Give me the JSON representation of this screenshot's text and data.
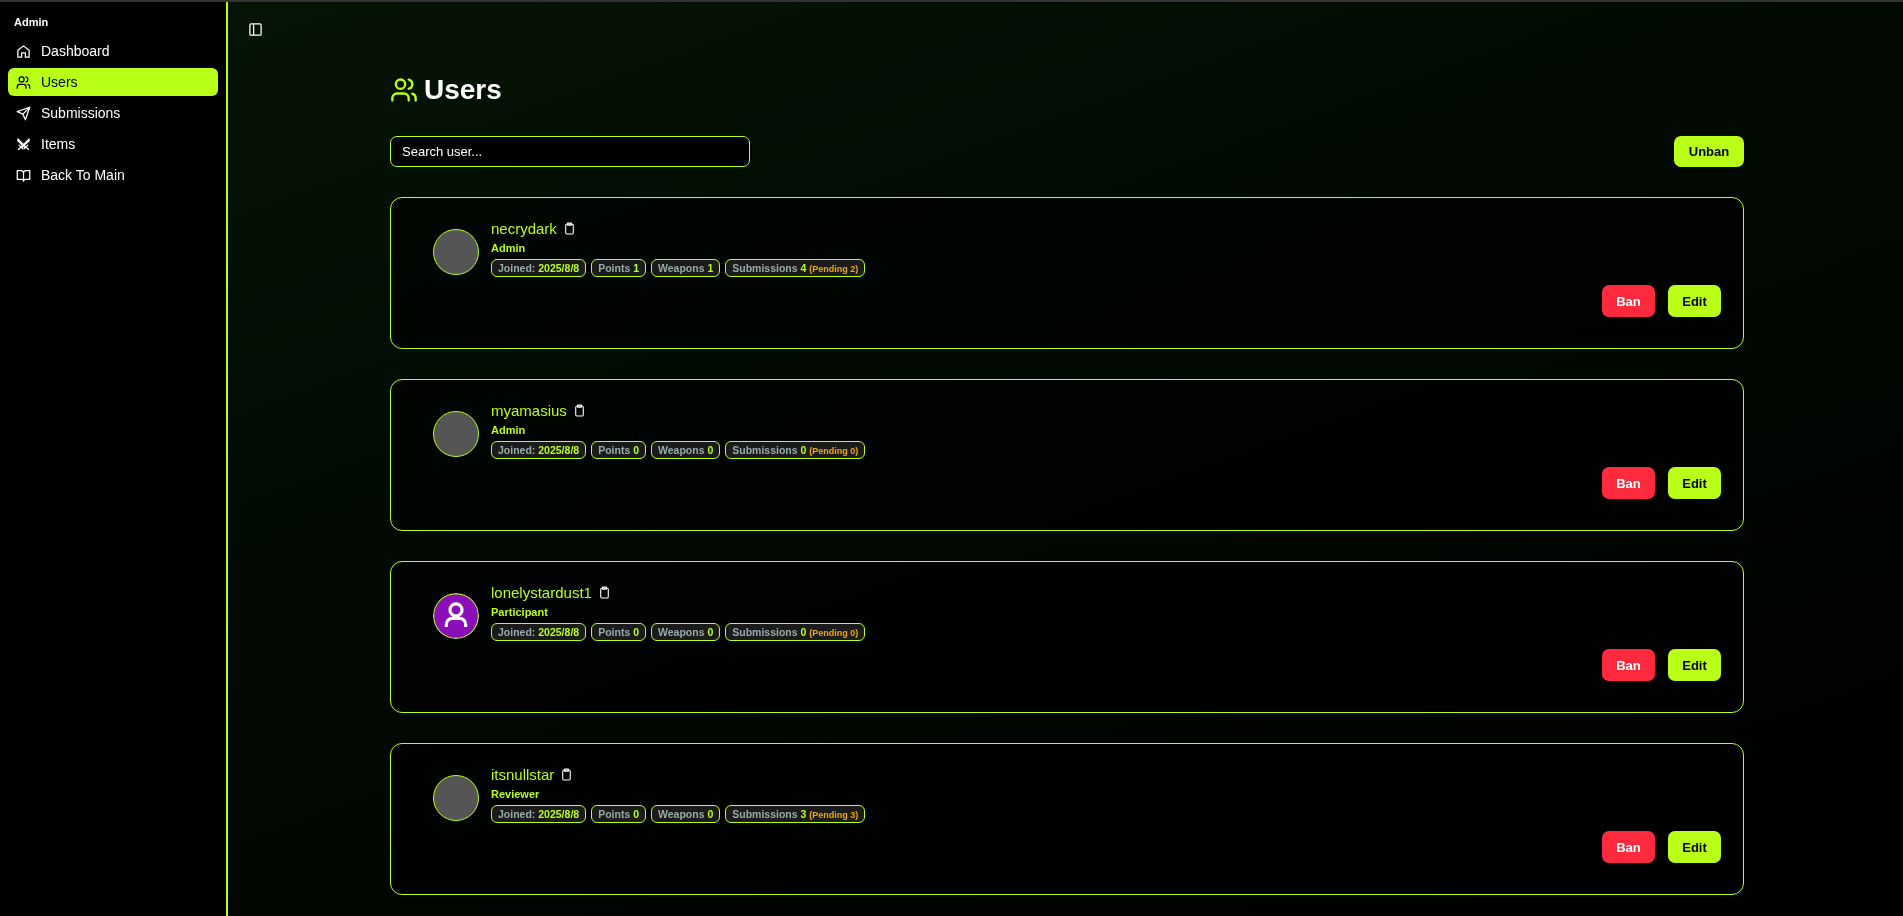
{
  "sidebar": {
    "group_label": "Admin",
    "items": [
      {
        "label": "Dashboard",
        "kind": "home",
        "selected": false
      },
      {
        "label": "Users",
        "kind": "users",
        "selected": true
      },
      {
        "label": "Submissions",
        "kind": "send",
        "selected": false
      },
      {
        "label": "Items",
        "kind": "swords",
        "selected": false
      },
      {
        "label": "Back To Main",
        "kind": "book",
        "selected": false
      }
    ]
  },
  "page": {
    "title": "Users",
    "search": {
      "placeholder": "Search user..."
    },
    "unban_button": "Unban"
  },
  "users": [
    {
      "name": "necrydark",
      "role": "Admin",
      "kind": "photo",
      "joined_label": "Joined:",
      "joined": "2025/8/8",
      "points_label": "Points",
      "points": "1",
      "weapons_label": "Weapons",
      "weapons": "1",
      "submissions_label": "Submissions",
      "submissions": "4",
      "pending": "(Pending 2)",
      "ban": "Ban",
      "edit": "Edit"
    },
    {
      "name": "myamasius",
      "role": "Admin",
      "kind": "photo",
      "joined_label": "Joined:",
      "joined": "2025/8/8",
      "points_label": "Points",
      "points": "0",
      "weapons_label": "Weapons",
      "weapons": "0",
      "submissions_label": "Submissions",
      "submissions": "0",
      "pending": "(Pending 0)",
      "ban": "Ban",
      "edit": "Edit"
    },
    {
      "name": "lonelystardust1",
      "role": "Participant",
      "kind": "default",
      "joined_label": "Joined:",
      "joined": "2025/8/8",
      "points_label": "Points",
      "points": "0",
      "weapons_label": "Weapons",
      "weapons": "0",
      "submissions_label": "Submissions",
      "submissions": "0",
      "pending": "(Pending 0)",
      "ban": "Ban",
      "edit": "Edit"
    },
    {
      "name": "itsnullstar",
      "role": "Reviewer",
      "kind": "photo",
      "joined_label": "Joined:",
      "joined": "2025/8/8",
      "points_label": "Points",
      "points": "0",
      "weapons_label": "Weapons",
      "weapons": "0",
      "submissions_label": "Submissions",
      "submissions": "3",
      "pending": "(Pending 3)",
      "ban": "Ban",
      "edit": "Edit"
    }
  ]
}
